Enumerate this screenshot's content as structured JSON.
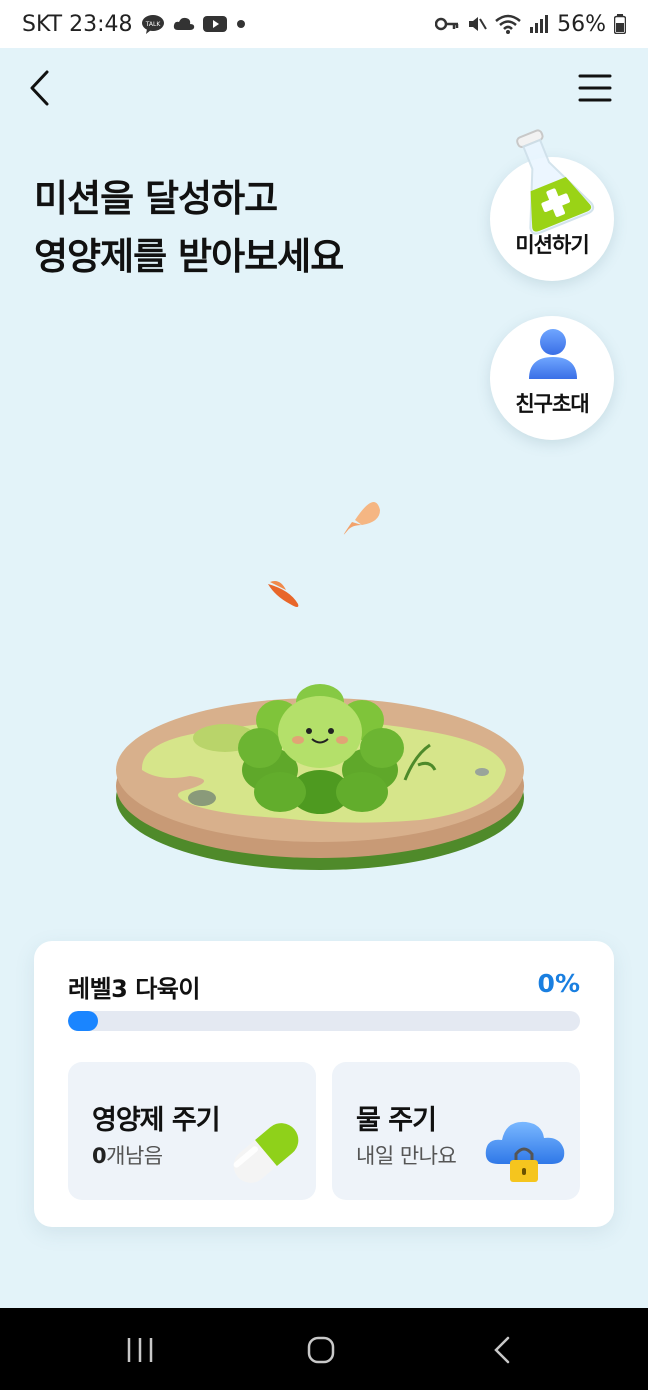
{
  "status_bar": {
    "carrier_time": "SKT 23:48",
    "battery": "56%",
    "left_icons": [
      "kakaotalk-icon",
      "cloud-icon",
      "youtube-icon",
      "dot-icon"
    ],
    "right_icons": [
      "key-icon",
      "mute-icon",
      "wifi-icon",
      "signal-icon",
      "battery-icon"
    ]
  },
  "header": {
    "headline_line1": "미션을 달성하고",
    "headline_line2": "영양제를 받아보세요"
  },
  "side_buttons": {
    "mission_label": "미션하기",
    "invite_label": "친구초대"
  },
  "level_card": {
    "level_name": "레벨3 다육이",
    "progress_text": "0%",
    "progress": 0
  },
  "actions": {
    "nutrient": {
      "title": "영양제 주기",
      "count": "0",
      "suffix": "개남음"
    },
    "water": {
      "title": "물 주기",
      "sub": "내일 만나요"
    }
  },
  "colors": {
    "background": "#e3f3f9",
    "accent": "#1a7fe0",
    "card": "#ffffff",
    "action_bg": "#eef3f9"
  },
  "nav": {
    "buttons": [
      "recent-apps",
      "home",
      "back"
    ]
  }
}
